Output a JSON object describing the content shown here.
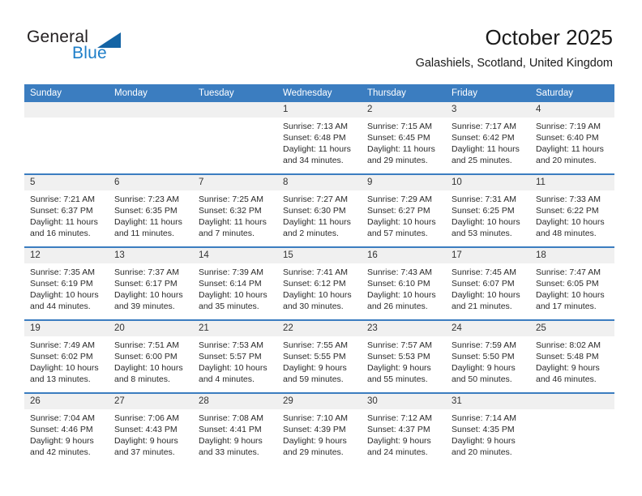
{
  "brand": {
    "name_top": "General",
    "name_bottom": "Blue",
    "accent_color": "#1d7ec8",
    "triangle_color": "#1464a5"
  },
  "header": {
    "title": "October 2025",
    "subtitle": "Galashiels, Scotland, United Kingdom"
  },
  "theme": {
    "header_row_bg": "#3b7dc0",
    "day_strip_bg": "#f0f0f0",
    "grid_line": "#3b7dc0"
  },
  "weekday_headers": [
    "Sunday",
    "Monday",
    "Tuesday",
    "Wednesday",
    "Thursday",
    "Friday",
    "Saturday"
  ],
  "weeks": [
    {
      "days": [
        {
          "num": "",
          "blank": true,
          "sunrise": "",
          "sunset": "",
          "daylight_line1": "",
          "daylight_line2": ""
        },
        {
          "num": "",
          "blank": true,
          "sunrise": "",
          "sunset": "",
          "daylight_line1": "",
          "daylight_line2": ""
        },
        {
          "num": "",
          "blank": true,
          "sunrise": "",
          "sunset": "",
          "daylight_line1": "",
          "daylight_line2": ""
        },
        {
          "num": "1",
          "blank": false,
          "sunrise": "Sunrise: 7:13 AM",
          "sunset": "Sunset: 6:48 PM",
          "daylight_line1": "Daylight: 11 hours",
          "daylight_line2": "and 34 minutes."
        },
        {
          "num": "2",
          "blank": false,
          "sunrise": "Sunrise: 7:15 AM",
          "sunset": "Sunset: 6:45 PM",
          "daylight_line1": "Daylight: 11 hours",
          "daylight_line2": "and 29 minutes."
        },
        {
          "num": "3",
          "blank": false,
          "sunrise": "Sunrise: 7:17 AM",
          "sunset": "Sunset: 6:42 PM",
          "daylight_line1": "Daylight: 11 hours",
          "daylight_line2": "and 25 minutes."
        },
        {
          "num": "4",
          "blank": false,
          "sunrise": "Sunrise: 7:19 AM",
          "sunset": "Sunset: 6:40 PM",
          "daylight_line1": "Daylight: 11 hours",
          "daylight_line2": "and 20 minutes."
        }
      ]
    },
    {
      "days": [
        {
          "num": "5",
          "blank": false,
          "sunrise": "Sunrise: 7:21 AM",
          "sunset": "Sunset: 6:37 PM",
          "daylight_line1": "Daylight: 11 hours",
          "daylight_line2": "and 16 minutes."
        },
        {
          "num": "6",
          "blank": false,
          "sunrise": "Sunrise: 7:23 AM",
          "sunset": "Sunset: 6:35 PM",
          "daylight_line1": "Daylight: 11 hours",
          "daylight_line2": "and 11 minutes."
        },
        {
          "num": "7",
          "blank": false,
          "sunrise": "Sunrise: 7:25 AM",
          "sunset": "Sunset: 6:32 PM",
          "daylight_line1": "Daylight: 11 hours",
          "daylight_line2": "and 7 minutes."
        },
        {
          "num": "8",
          "blank": false,
          "sunrise": "Sunrise: 7:27 AM",
          "sunset": "Sunset: 6:30 PM",
          "daylight_line1": "Daylight: 11 hours",
          "daylight_line2": "and 2 minutes."
        },
        {
          "num": "9",
          "blank": false,
          "sunrise": "Sunrise: 7:29 AM",
          "sunset": "Sunset: 6:27 PM",
          "daylight_line1": "Daylight: 10 hours",
          "daylight_line2": "and 57 minutes."
        },
        {
          "num": "10",
          "blank": false,
          "sunrise": "Sunrise: 7:31 AM",
          "sunset": "Sunset: 6:25 PM",
          "daylight_line1": "Daylight: 10 hours",
          "daylight_line2": "and 53 minutes."
        },
        {
          "num": "11",
          "blank": false,
          "sunrise": "Sunrise: 7:33 AM",
          "sunset": "Sunset: 6:22 PM",
          "daylight_line1": "Daylight: 10 hours",
          "daylight_line2": "and 48 minutes."
        }
      ]
    },
    {
      "days": [
        {
          "num": "12",
          "blank": false,
          "sunrise": "Sunrise: 7:35 AM",
          "sunset": "Sunset: 6:19 PM",
          "daylight_line1": "Daylight: 10 hours",
          "daylight_line2": "and 44 minutes."
        },
        {
          "num": "13",
          "blank": false,
          "sunrise": "Sunrise: 7:37 AM",
          "sunset": "Sunset: 6:17 PM",
          "daylight_line1": "Daylight: 10 hours",
          "daylight_line2": "and 39 minutes."
        },
        {
          "num": "14",
          "blank": false,
          "sunrise": "Sunrise: 7:39 AM",
          "sunset": "Sunset: 6:14 PM",
          "daylight_line1": "Daylight: 10 hours",
          "daylight_line2": "and 35 minutes."
        },
        {
          "num": "15",
          "blank": false,
          "sunrise": "Sunrise: 7:41 AM",
          "sunset": "Sunset: 6:12 PM",
          "daylight_line1": "Daylight: 10 hours",
          "daylight_line2": "and 30 minutes."
        },
        {
          "num": "16",
          "blank": false,
          "sunrise": "Sunrise: 7:43 AM",
          "sunset": "Sunset: 6:10 PM",
          "daylight_line1": "Daylight: 10 hours",
          "daylight_line2": "and 26 minutes."
        },
        {
          "num": "17",
          "blank": false,
          "sunrise": "Sunrise: 7:45 AM",
          "sunset": "Sunset: 6:07 PM",
          "daylight_line1": "Daylight: 10 hours",
          "daylight_line2": "and 21 minutes."
        },
        {
          "num": "18",
          "blank": false,
          "sunrise": "Sunrise: 7:47 AM",
          "sunset": "Sunset: 6:05 PM",
          "daylight_line1": "Daylight: 10 hours",
          "daylight_line2": "and 17 minutes."
        }
      ]
    },
    {
      "days": [
        {
          "num": "19",
          "blank": false,
          "sunrise": "Sunrise: 7:49 AM",
          "sunset": "Sunset: 6:02 PM",
          "daylight_line1": "Daylight: 10 hours",
          "daylight_line2": "and 13 minutes."
        },
        {
          "num": "20",
          "blank": false,
          "sunrise": "Sunrise: 7:51 AM",
          "sunset": "Sunset: 6:00 PM",
          "daylight_line1": "Daylight: 10 hours",
          "daylight_line2": "and 8 minutes."
        },
        {
          "num": "21",
          "blank": false,
          "sunrise": "Sunrise: 7:53 AM",
          "sunset": "Sunset: 5:57 PM",
          "daylight_line1": "Daylight: 10 hours",
          "daylight_line2": "and 4 minutes."
        },
        {
          "num": "22",
          "blank": false,
          "sunrise": "Sunrise: 7:55 AM",
          "sunset": "Sunset: 5:55 PM",
          "daylight_line1": "Daylight: 9 hours",
          "daylight_line2": "and 59 minutes."
        },
        {
          "num": "23",
          "blank": false,
          "sunrise": "Sunrise: 7:57 AM",
          "sunset": "Sunset: 5:53 PM",
          "daylight_line1": "Daylight: 9 hours",
          "daylight_line2": "and 55 minutes."
        },
        {
          "num": "24",
          "blank": false,
          "sunrise": "Sunrise: 7:59 AM",
          "sunset": "Sunset: 5:50 PM",
          "daylight_line1": "Daylight: 9 hours",
          "daylight_line2": "and 50 minutes."
        },
        {
          "num": "25",
          "blank": false,
          "sunrise": "Sunrise: 8:02 AM",
          "sunset": "Sunset: 5:48 PM",
          "daylight_line1": "Daylight: 9 hours",
          "daylight_line2": "and 46 minutes."
        }
      ]
    },
    {
      "days": [
        {
          "num": "26",
          "blank": false,
          "sunrise": "Sunrise: 7:04 AM",
          "sunset": "Sunset: 4:46 PM",
          "daylight_line1": "Daylight: 9 hours",
          "daylight_line2": "and 42 minutes."
        },
        {
          "num": "27",
          "blank": false,
          "sunrise": "Sunrise: 7:06 AM",
          "sunset": "Sunset: 4:43 PM",
          "daylight_line1": "Daylight: 9 hours",
          "daylight_line2": "and 37 minutes."
        },
        {
          "num": "28",
          "blank": false,
          "sunrise": "Sunrise: 7:08 AM",
          "sunset": "Sunset: 4:41 PM",
          "daylight_line1": "Daylight: 9 hours",
          "daylight_line2": "and 33 minutes."
        },
        {
          "num": "29",
          "blank": false,
          "sunrise": "Sunrise: 7:10 AM",
          "sunset": "Sunset: 4:39 PM",
          "daylight_line1": "Daylight: 9 hours",
          "daylight_line2": "and 29 minutes."
        },
        {
          "num": "30",
          "blank": false,
          "sunrise": "Sunrise: 7:12 AM",
          "sunset": "Sunset: 4:37 PM",
          "daylight_line1": "Daylight: 9 hours",
          "daylight_line2": "and 24 minutes."
        },
        {
          "num": "31",
          "blank": false,
          "sunrise": "Sunrise: 7:14 AM",
          "sunset": "Sunset: 4:35 PM",
          "daylight_line1": "Daylight: 9 hours",
          "daylight_line2": "and 20 minutes."
        },
        {
          "num": "",
          "blank": true,
          "sunrise": "",
          "sunset": "",
          "daylight_line1": "",
          "daylight_line2": ""
        }
      ]
    }
  ]
}
